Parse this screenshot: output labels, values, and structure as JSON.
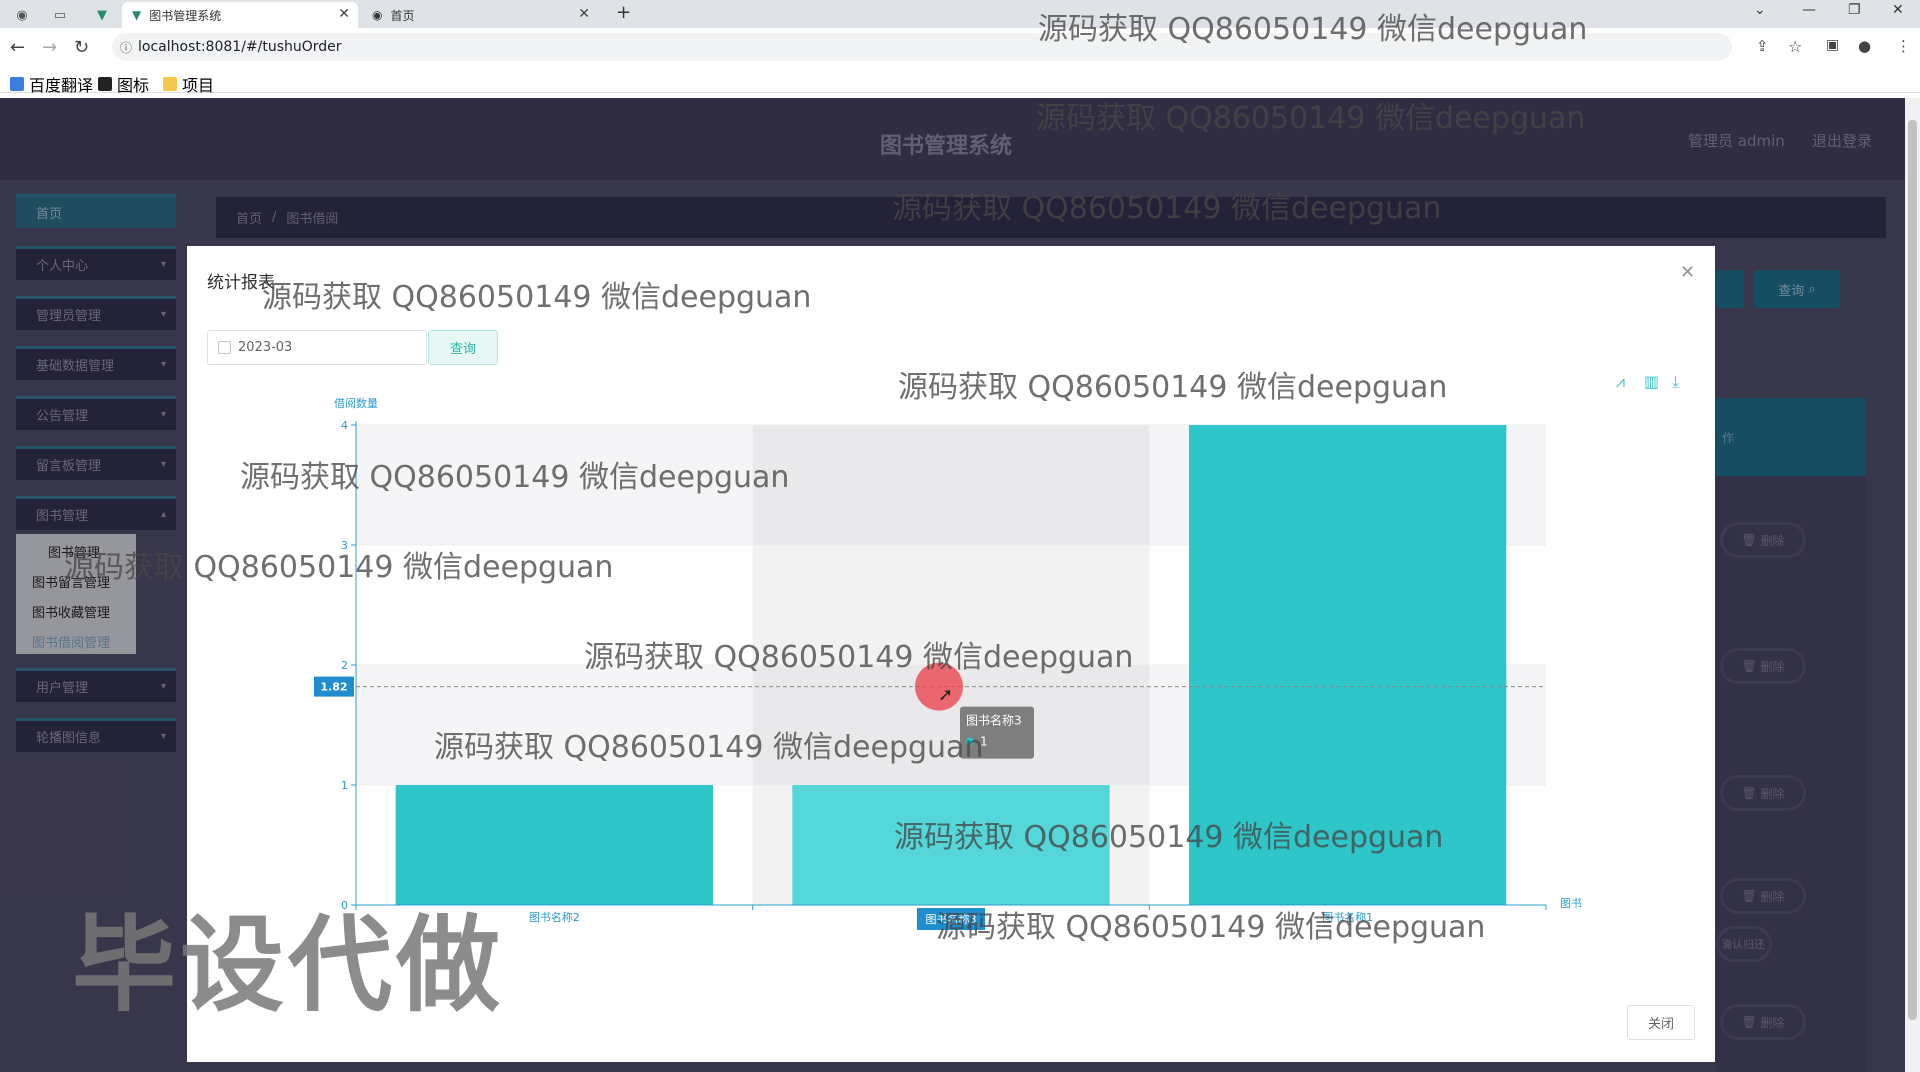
{
  "browser": {
    "tabs": [
      {
        "label": "图书管理系统",
        "active": true
      },
      {
        "label": "首页",
        "active": false
      }
    ],
    "url": "localhost:8081/#/tushuOrder",
    "bookmarks": [
      "百度翻译",
      "图标",
      "项目"
    ]
  },
  "app": {
    "title": "图书管理系统",
    "user_label": "管理员 admin",
    "logout_label": "退出登录",
    "sidebar": [
      {
        "label": "首页",
        "has_children": false
      },
      {
        "label": "个人中心",
        "has_children": true
      },
      {
        "label": "管理员管理",
        "has_children": true
      },
      {
        "label": "基础数据管理",
        "has_children": true
      },
      {
        "label": "公告管理",
        "has_children": true
      },
      {
        "label": "留言板管理",
        "has_children": true
      },
      {
        "label": "图书管理",
        "has_children": true,
        "children": [
          "图书管理",
          "图书留言管理",
          "图书收藏管理",
          "图书借阅管理"
        ]
      },
      {
        "label": "用户管理",
        "has_children": true
      },
      {
        "label": "轮播图信息",
        "has_children": true
      }
    ],
    "breadcrumb": [
      "首页",
      "图书借阅"
    ],
    "background_buttons": {
      "query": "查询",
      "column_header": "操作",
      "delete": "删除",
      "confirm_return": "确认归还"
    }
  },
  "dialog": {
    "title": "统计报表",
    "date_value": "2023-03",
    "query_label": "查询",
    "close_label": "关闭"
  },
  "chart_data": {
    "type": "bar",
    "ylabel": "借阅数量",
    "xlabel": "图书",
    "categories": [
      "图书名称2",
      "图书名称3",
      "图书名称1"
    ],
    "values": [
      1,
      1,
      4
    ],
    "ylim": [
      0,
      4
    ],
    "yticks": [
      0,
      1,
      2,
      3,
      4
    ],
    "axis_pointer_value": "1.82",
    "tooltip": {
      "title": "图书名称3",
      "value": "1"
    },
    "colors": {
      "bar": "#2ec6c8",
      "bar_highlight": "#55d6d8",
      "axis": "#2a9ccf"
    }
  },
  "watermarks": [
    "源码获取 QQ86050149 微信deepguan",
    "源码获取 QQ86050149 微信deepguan",
    "源码获取 QQ86050149 微信deepguan",
    "源码获取 QQ86050149 微信deepguan",
    "源码获取 QQ86050149 微信deepguan",
    "源码获取 QQ86050149 微信deepguan",
    "源码获取 QQ86050149 微信deepguan",
    "源码获取 QQ86050149 微信deepguan",
    "源码获取 QQ86050149 微信deepguan",
    "源码获取 QQ86050149 微信deepguan",
    "源码获取 QQ86050149 微信deepguan"
  ],
  "big_watermark": "毕设代做"
}
